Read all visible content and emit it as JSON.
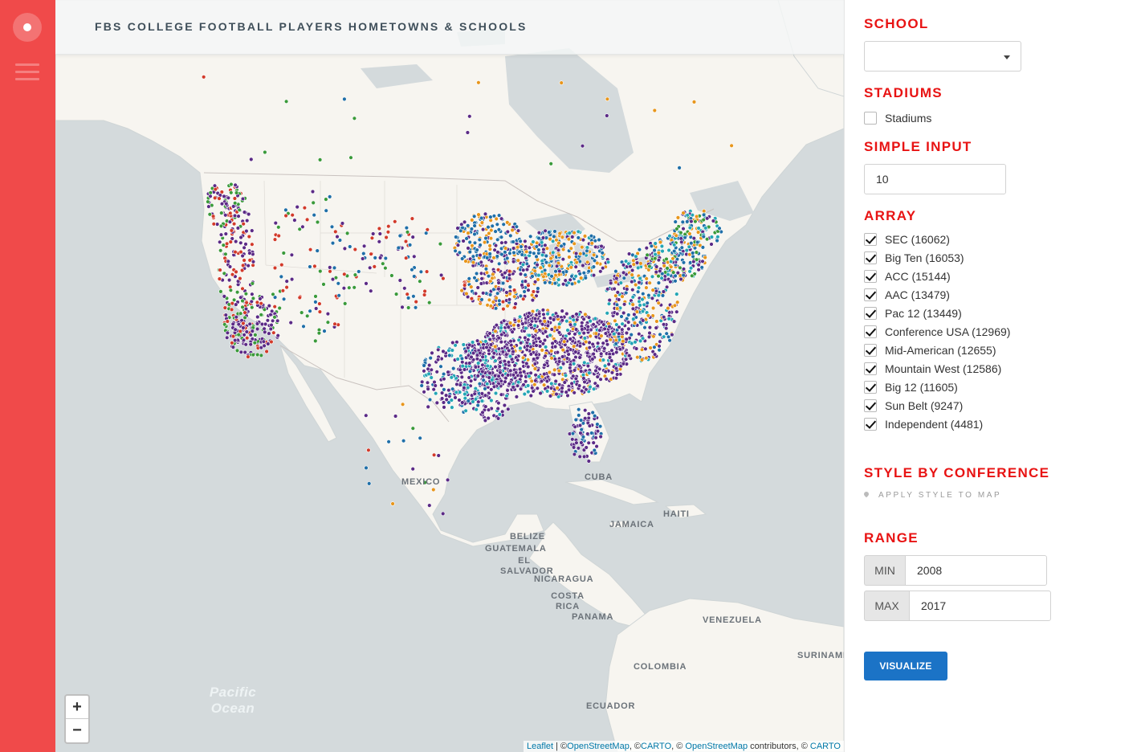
{
  "header": {
    "title": "FBS COLLEGE FOOTBALL PLAYERS HOMETOWNS & SCHOOLS"
  },
  "map": {
    "zoom_in": "+",
    "zoom_out": "−",
    "place_labels": [
      "MEXICO",
      "CUBA",
      "HAITI",
      "JAMAICA",
      "BELIZE",
      "GUATEMALA",
      "EL SALVADOR",
      "NICARAGUA",
      "COSTA RICA",
      "PANAMA",
      "VENEZUELA",
      "COLOMBIA",
      "ECUADOR",
      "SURINAME"
    ],
    "ocean_label": "Pacific Ocean",
    "attribution": {
      "leaflet": "Leaflet",
      "sep1": " | ©",
      "osm1": "OpenStreetMap",
      "sep2": ", ©",
      "carto1": "CARTO",
      "sep3": ", © ",
      "osm2": "OpenStreetMap",
      "sep4": " contributors, © ",
      "carto2": "CARTO"
    },
    "colors": {
      "water": "#d4dadc",
      "land": "#f7f5f0",
      "purple": "#5b2a86",
      "blue": "#1f6fa8",
      "orange": "#e8961c",
      "green": "#3a9a3a",
      "red": "#d23a2a",
      "teal": "#24a6b5"
    }
  },
  "panel": {
    "school": {
      "heading": "SCHOOL",
      "value": ""
    },
    "stadiums": {
      "heading": "STADIUMS",
      "label": "Stadiums",
      "checked": false
    },
    "simple_input": {
      "heading": "SIMPLE INPUT",
      "value": "10"
    },
    "array": {
      "heading": "ARRAY",
      "items": [
        {
          "label": "SEC (16062)",
          "checked": true
        },
        {
          "label": "Big Ten (16053)",
          "checked": true
        },
        {
          "label": "ACC (15144)",
          "checked": true
        },
        {
          "label": "AAC (13479)",
          "checked": true
        },
        {
          "label": "Pac 12 (13449)",
          "checked": true
        },
        {
          "label": "Conference USA (12969)",
          "checked": true
        },
        {
          "label": "Mid-American (12655)",
          "checked": true
        },
        {
          "label": "Mountain West (12586)",
          "checked": true
        },
        {
          "label": "Big 12 (11605)",
          "checked": true
        },
        {
          "label": "Sun Belt (9247)",
          "checked": true
        },
        {
          "label": "Independent (4481)",
          "checked": true
        }
      ]
    },
    "style": {
      "heading": "STYLE BY CONFERENCE",
      "apply_label": "APPLY STYLE TO MAP"
    },
    "range": {
      "heading": "RANGE",
      "min_label": "MIN",
      "min_value": "2008",
      "max_label": "MAX",
      "max_value": "2017"
    },
    "visualize_label": "VISUALIZE"
  }
}
